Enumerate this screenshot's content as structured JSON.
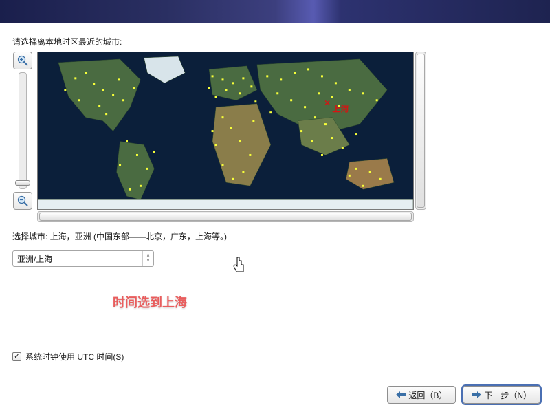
{
  "prompt": "请选择离本地时区最近的城市:",
  "map": {
    "selected_city_label": "上海"
  },
  "selected_city_line_prefix": "选择城市: ",
  "selected_city_line": "上海，亚洲 (中国东部——北京，广东，上海等。)",
  "timezone_select": {
    "value": "亚洲/上海"
  },
  "utc_checkbox": {
    "label": "系统时钟使用 UTC 时间(S)",
    "checked": true
  },
  "annotation": "时间选到上海",
  "buttons": {
    "back": "返回（B）",
    "next": "下一步（N）"
  },
  "icons": {
    "zoom_in": "zoom-in-icon",
    "zoom_out": "zoom-out-icon",
    "arrow_left": "arrow-left-icon",
    "arrow_right": "arrow-right-icon",
    "checkmark": "✓",
    "spin_up": "˄",
    "spin_down": "˅"
  }
}
